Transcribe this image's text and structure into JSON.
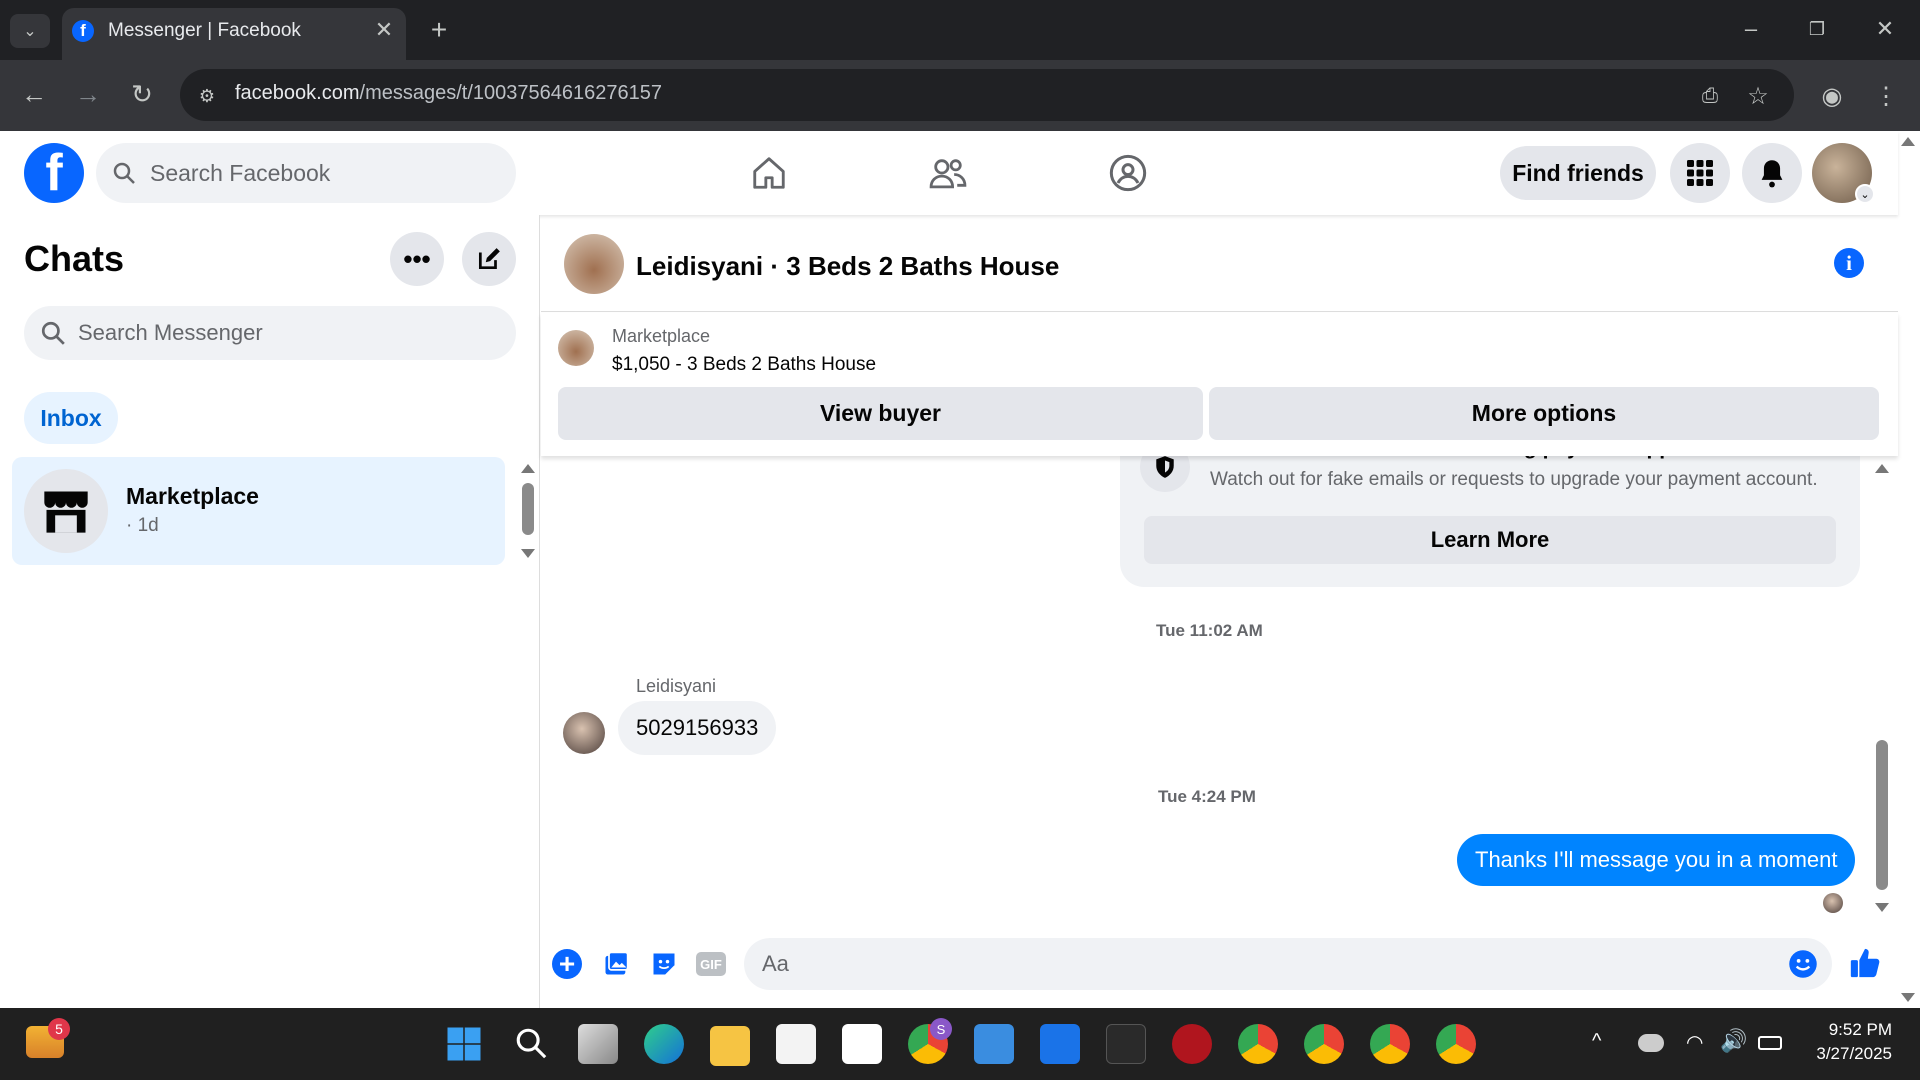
{
  "browser": {
    "tab_title": "Messenger | Facebook",
    "url_domain": "facebook.com",
    "url_path": "/messages/t/10037564616276157"
  },
  "facebook_header": {
    "search_placeholder": "Search Facebook",
    "find_friends_label": "Find friends"
  },
  "sidebar": {
    "title": "Chats",
    "search_placeholder": "Search Messenger",
    "inbox_label": "Inbox",
    "chats": [
      {
        "name": "Marketplace",
        "time": "· 1d"
      }
    ]
  },
  "conversation": {
    "title": "Leidisyani · 3 Beds 2 Baths House",
    "marketplace_label": "Marketplace",
    "listing": "$1,050 - 3 Beds 2 Baths House",
    "view_buyer_label": "View buyer",
    "more_options_label": "More options",
    "scam_notice_title": "Beware of common scams using payment apps",
    "scam_notice_text": "Watch out for fake emails or requests to upgrade your payment account.",
    "learn_more_label": "Learn More",
    "messages": [
      {
        "timestamp": "Tue 11:02 AM",
        "sender": "Leidisyani",
        "text": "5029156933",
        "direction": "incoming"
      },
      {
        "timestamp": "Tue 4:24 PM",
        "text": "Thanks I'll message you in a moment",
        "direction": "outgoing"
      }
    ],
    "composer_placeholder": "Aa",
    "gif_label": "GIF"
  },
  "taskbar": {
    "widget_badge": "5",
    "profile_badge": "S",
    "time": "9:52 PM",
    "date": "3/27/2025"
  },
  "colors": {
    "facebook_blue": "#0866ff",
    "messenger_blue": "#0084ff",
    "inbox_highlight": "#e7f3ff"
  }
}
